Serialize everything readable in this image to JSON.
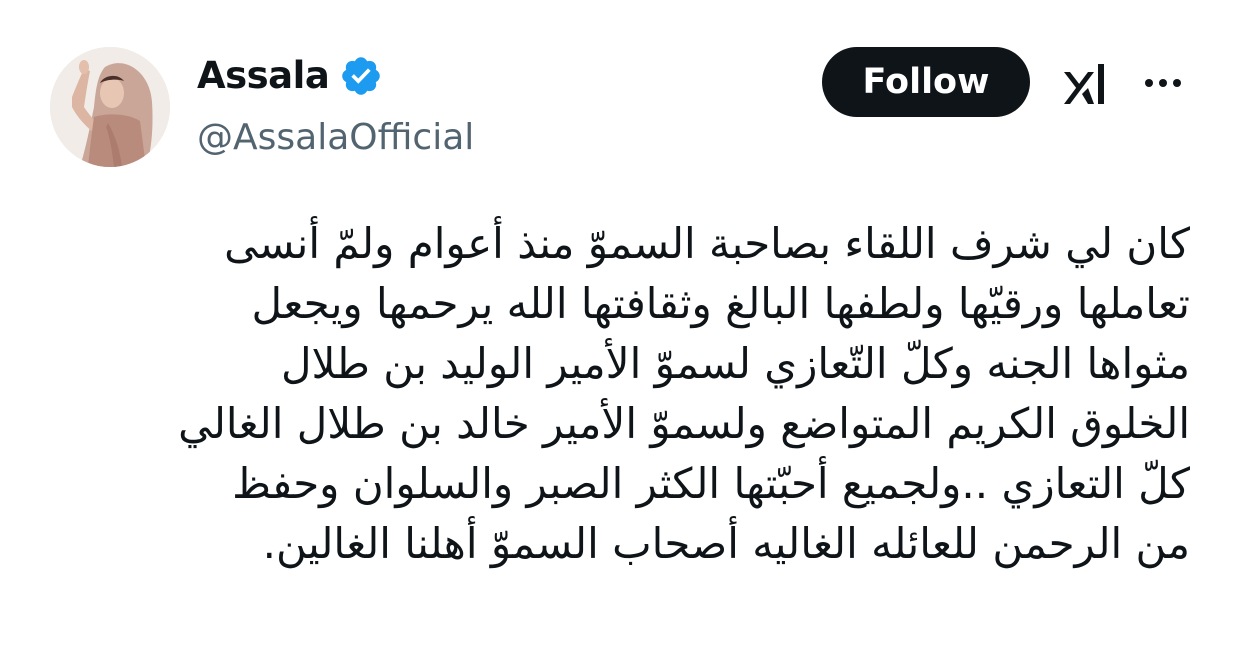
{
  "author": {
    "display_name": "Assala",
    "handle": "@AssalaOfficial",
    "verified": true
  },
  "actions": {
    "follow_label": "Follow"
  },
  "icons": {
    "verified": "verified-badge-icon",
    "grok": "grok-icon",
    "more": "more-options-icon"
  },
  "colors": {
    "text": "#0f1419",
    "secondary": "#536471",
    "verified_blue": "#1d9bf0",
    "follow_bg": "#0f1419"
  },
  "tweet": {
    "lines": [
      "كان لي شرف اللقاء بصاحبة السموّ منذ أعوام ولمّ أنسى",
      "تعاملها ورقيّها ولطفها البالغ وثقافتها الله يرحمها ويجعل",
      "مثواها الجنه وكلّ التّعازي لسموّ الأمير الوليد بن طلال",
      "الخلوق الكريم المتواضع ولسموّ الأمير خالد بن طلال الغالي",
      "كلّ التعازي  ..ولجميع أحبّتها الكثر الصبر والسلوان وحفظ",
      "من الرحمن للعائله الغاليه أصحاب السموّ أهلنا الغالين."
    ]
  }
}
